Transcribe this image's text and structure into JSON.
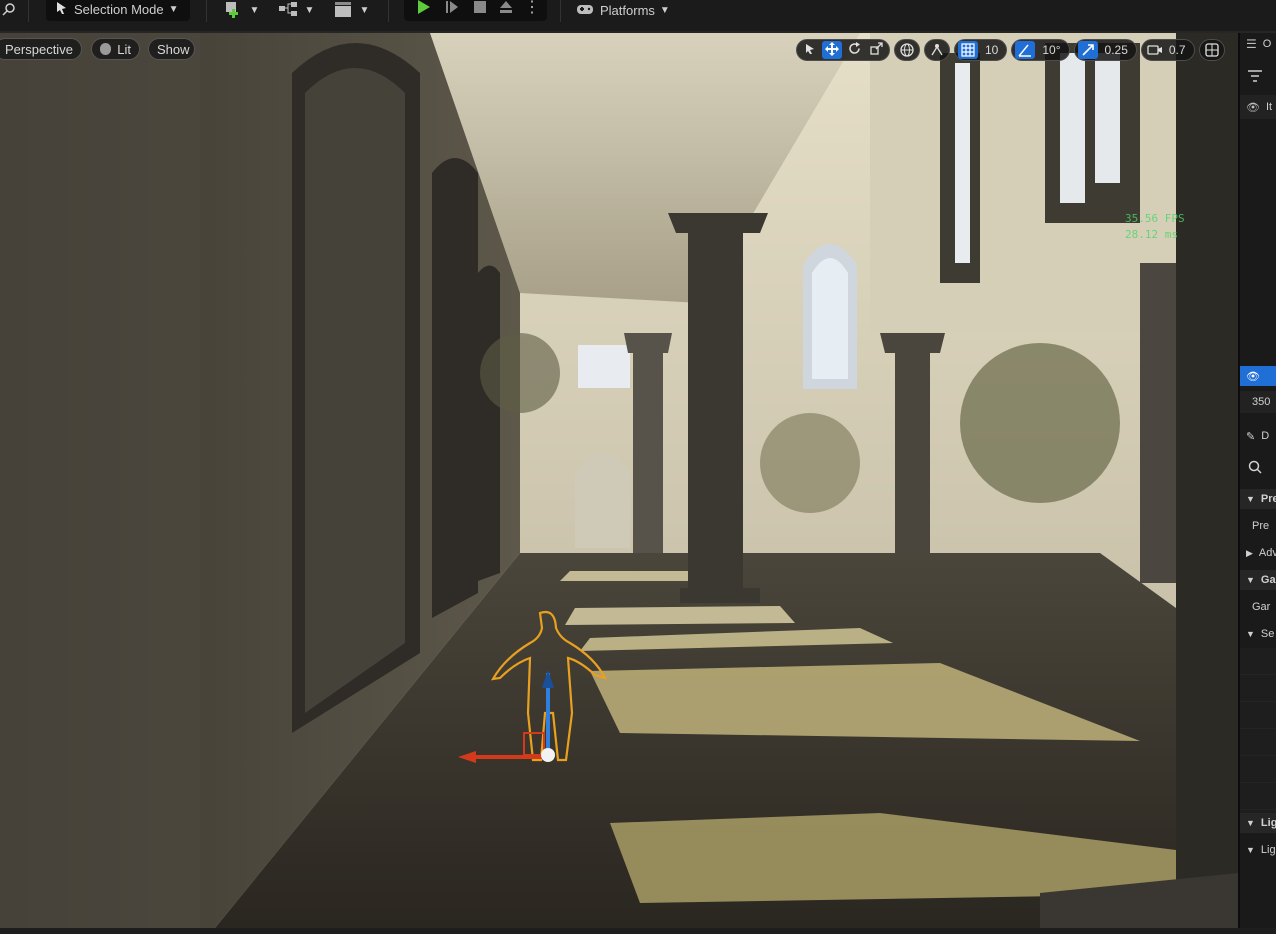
{
  "toolbar": {
    "selection_mode_label": "Selection Mode",
    "platforms_label": "Platforms"
  },
  "viewport": {
    "perspective_label": "Perspective",
    "lit_label": "Lit",
    "show_label": "Show",
    "grid_snap_value": "10",
    "rotation_snap_value": "10°",
    "scale_snap_value": "0.25",
    "camera_speed_value": "0.7",
    "fps_text": "35.56 FPS",
    "ms_text": "28.12 ms"
  },
  "right_panel": {
    "outliner_title": "O",
    "item_label": "It",
    "count_value": "350",
    "details_label": "D",
    "rows": [
      "Pre",
      "Pre",
      "Adv",
      "Gar",
      "Gar",
      "Se",
      "Lig",
      "Lig"
    ]
  },
  "colors": {
    "accent": "#1f6fd6",
    "play_green": "#5ecb3a",
    "selection_outline": "#e8a020",
    "fps_green": "#4cd46a"
  }
}
